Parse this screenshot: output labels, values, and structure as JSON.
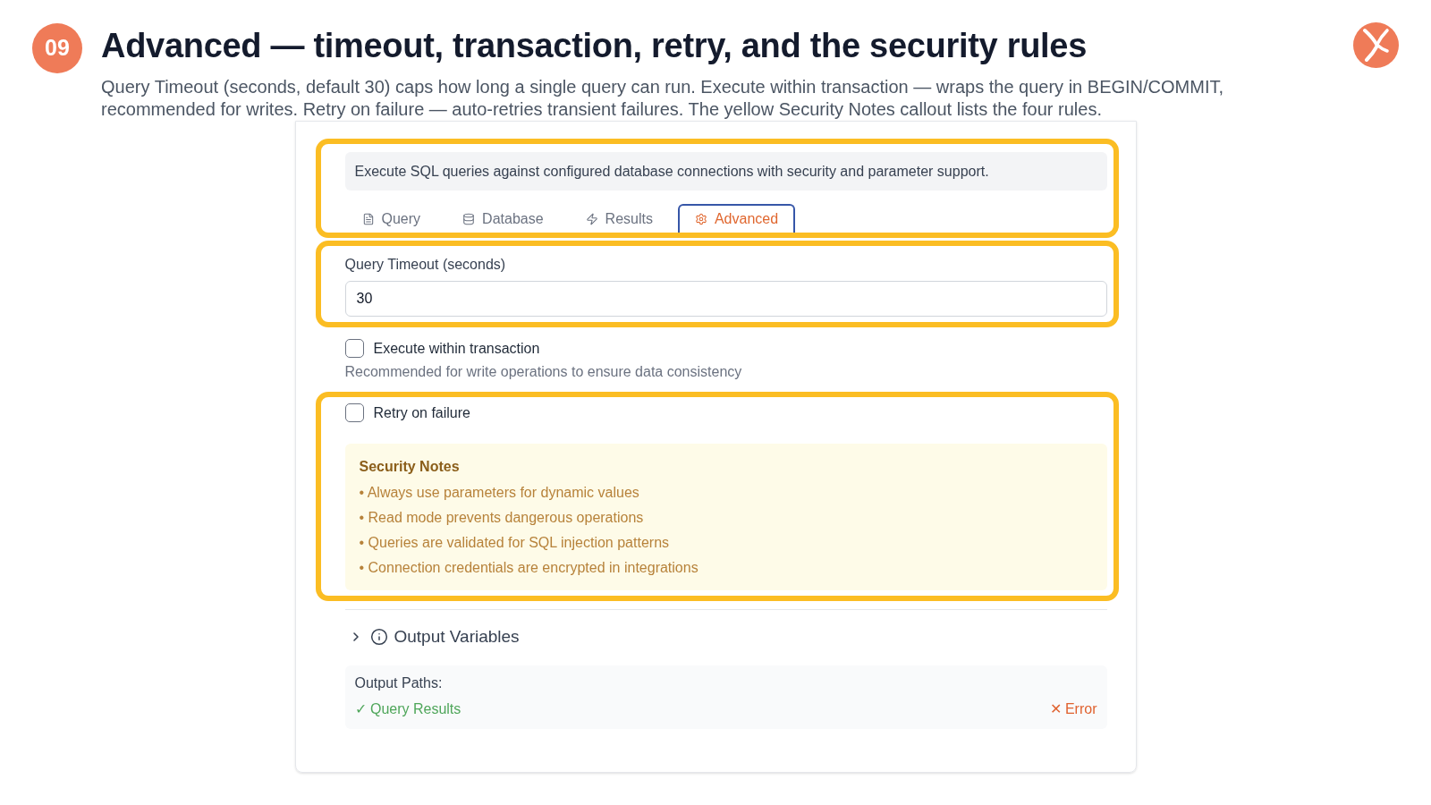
{
  "slide": {
    "number": "09",
    "title": "Advanced — timeout, transaction, retry, and the security rules",
    "subtitle": "Query Timeout (seconds, default 30) caps how long a single query can run. Execute within transaction — wraps the query in BEGIN/COMMIT, recommended for writes. Retry on failure — auto-retries transient failures. The yellow Security Notes callout lists the four rules."
  },
  "panel": {
    "header": {
      "highlighted": true,
      "description": "Execute SQL queries against configured database connections with security and parameter support.",
      "tabs": [
        {
          "label": "Query",
          "selected": false
        },
        {
          "label": "Database",
          "selected": false
        },
        {
          "label": "Results",
          "selected": false
        },
        {
          "label": "Advanced",
          "selected": true
        }
      ]
    },
    "timeout": {
      "highlighted": true,
      "label": "Query Timeout (seconds)",
      "value": "30"
    },
    "transaction": {
      "label": "Execute within transaction",
      "checked": false,
      "hint": "Recommended for write operations to ensure data consistency"
    },
    "retry": {
      "highlighted": true,
      "label": "Retry on failure",
      "checked": false
    },
    "security_notes": {
      "title": "Security Notes",
      "items": [
        "• Always use parameters for dynamic values",
        "• Read mode prevents dangerous operations",
        "• Queries are validated for SQL injection patterns",
        "• Connection credentials are encrypted in integrations"
      ]
    },
    "output_variables": {
      "label": "Output Variables",
      "expanded": false,
      "paths_label": "Output Paths:",
      "paths": [
        {
          "kind": "success",
          "text": "✓ Query Results"
        },
        {
          "kind": "error",
          "text": "✕ Error"
        }
      ]
    }
  }
}
